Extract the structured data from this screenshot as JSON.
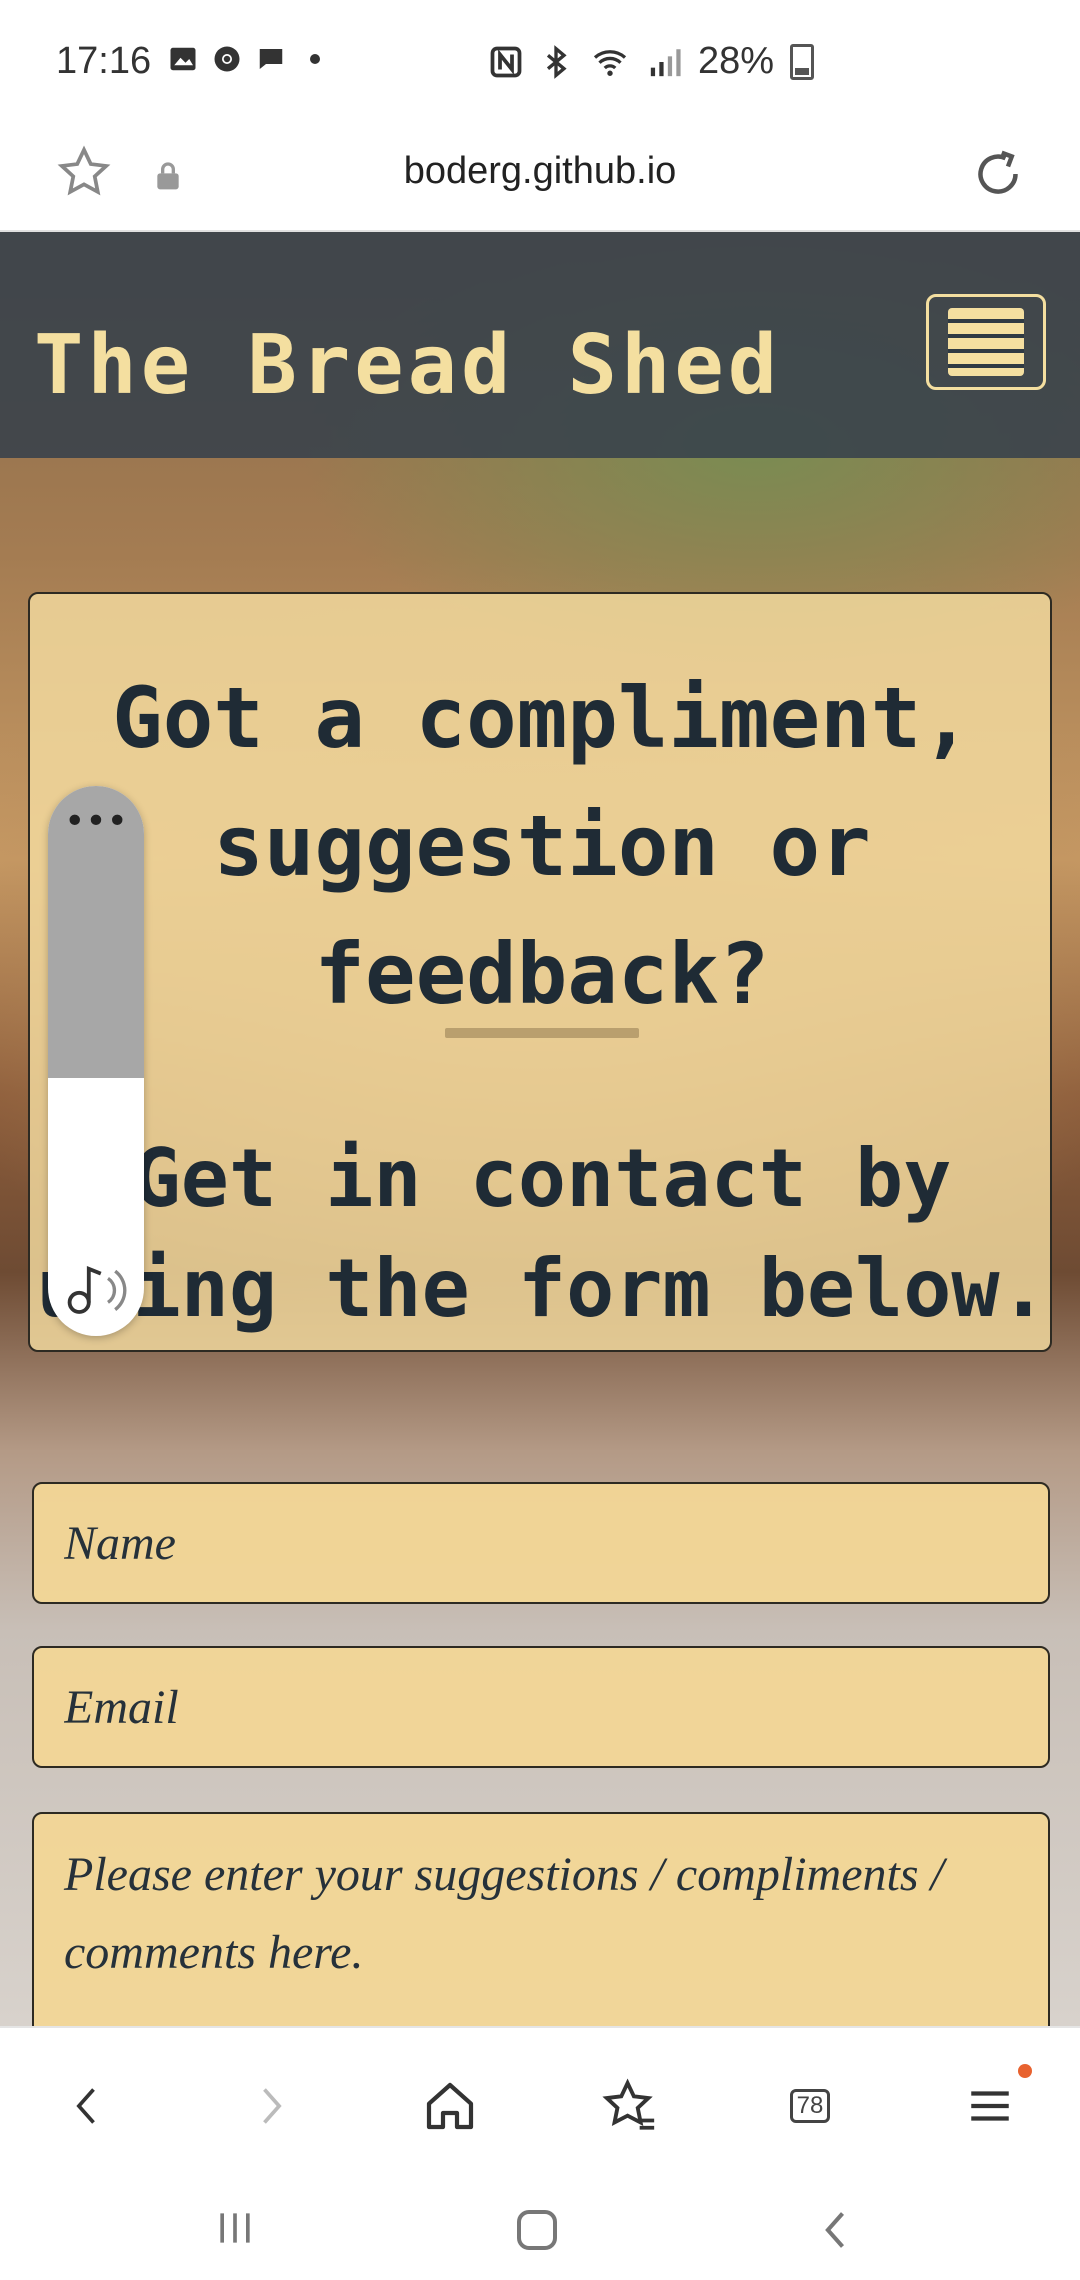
{
  "status_bar": {
    "time": "17:16",
    "battery": "28%",
    "notification_icons": [
      "image-icon",
      "chrome-icon",
      "chat-icon",
      "dot-icon"
    ],
    "system_icons": [
      "nfc-icon",
      "bluetooth-icon",
      "wifi-icon",
      "signal-icon",
      "battery-icon"
    ]
  },
  "browser": {
    "url": "boderg.github.io",
    "tabs_count": "78"
  },
  "site": {
    "brand": "The Bread Shed",
    "intro_heading": "Got a compliment, suggestion or feedback?",
    "intro_sub": "Get in contact by using the form below."
  },
  "form": {
    "name_placeholder": "Name",
    "email_placeholder": "Email",
    "message_placeholder": "Please enter your suggestions / compliments / comments here."
  },
  "media_widget": {
    "volume_level": 0.47
  },
  "colors": {
    "accent": "#f4dfa0",
    "header_bg": "#37414b",
    "card_text": "#1f2b35",
    "badge": "#e8622f"
  }
}
